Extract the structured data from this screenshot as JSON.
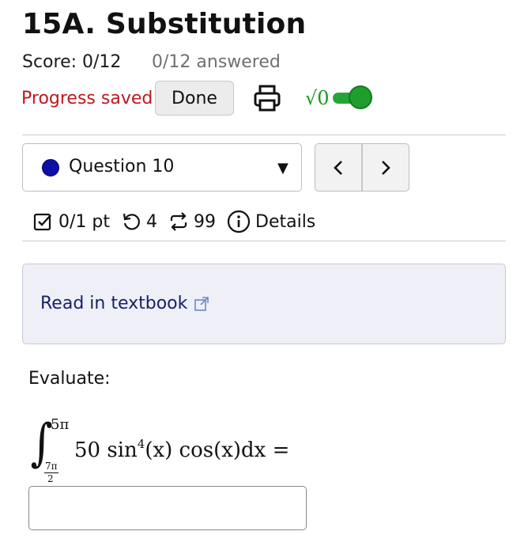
{
  "assignment": {
    "title": "15A. Substitution",
    "score": "Score: 0/12",
    "answered": "0/12 answered",
    "progress_status": "Progress saved",
    "done_label": "Done",
    "math_toggle_label": "√0"
  },
  "question_nav": {
    "selected": "Question 10",
    "status_color": "#0d0fa8",
    "prev_glyph": "‹",
    "next_glyph": "›"
  },
  "meta": {
    "points": "0/1 pt",
    "retries": "4",
    "attempts": "99",
    "details_label": "Details"
  },
  "textbook": {
    "link_label": "Read in textbook"
  },
  "question": {
    "prompt": "Evaluate:",
    "integral_upper": "5π",
    "integral_lower_numerator": "7π",
    "integral_lower_denominator": "2",
    "integrand_coefficient": "50 sin",
    "integrand_power": "4",
    "integrand_rest": "(x) cos(x)dx =",
    "answer_value": ""
  },
  "colors": {
    "progress_saved": "#c0171e",
    "toggle_on": "#1f9e2d",
    "link": "#17206e"
  }
}
